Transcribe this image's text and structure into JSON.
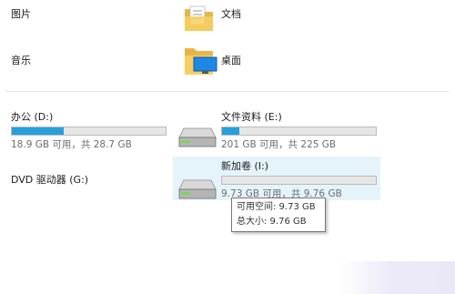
{
  "folders": [
    {
      "label": "图片",
      "icon": "pictures-folder-icon"
    },
    {
      "label": "文档",
      "icon": "documents-folder-icon"
    },
    {
      "label": "音乐",
      "icon": "music-folder-icon"
    },
    {
      "label": "桌面",
      "icon": "desktop-folder-icon"
    }
  ],
  "drives": [
    {
      "label": "办公 (D:)",
      "free_text": "18.9 GB 可用，共 28.7 GB",
      "used_fraction": 0.34,
      "icon": "hard-drive-icon"
    },
    {
      "label": "文件资料 (E:)",
      "free_text": "201 GB 可用，共 225 GB",
      "used_fraction": 0.11,
      "icon": "hard-drive-icon"
    },
    {
      "label": "DVD 驱动器 (G:)",
      "icon": "dvd-drive-icon"
    },
    {
      "label": "新加卷 (I:)",
      "free_text": "9.73 GB 可用，共 9.76 GB",
      "used_fraction": 0.0,
      "icon": "hard-drive-icon",
      "selected": true
    }
  ],
  "tooltip": {
    "line1": "可用空间: 9.73 GB",
    "line2": "总大小: 9.76 GB"
  },
  "colors": {
    "bar_fill": "#26a0da",
    "bar_track": "#e6e6e6",
    "selection": "#e5f3fb",
    "folder": "#f3c75a",
    "desktop_screen": "#1e88e5"
  }
}
